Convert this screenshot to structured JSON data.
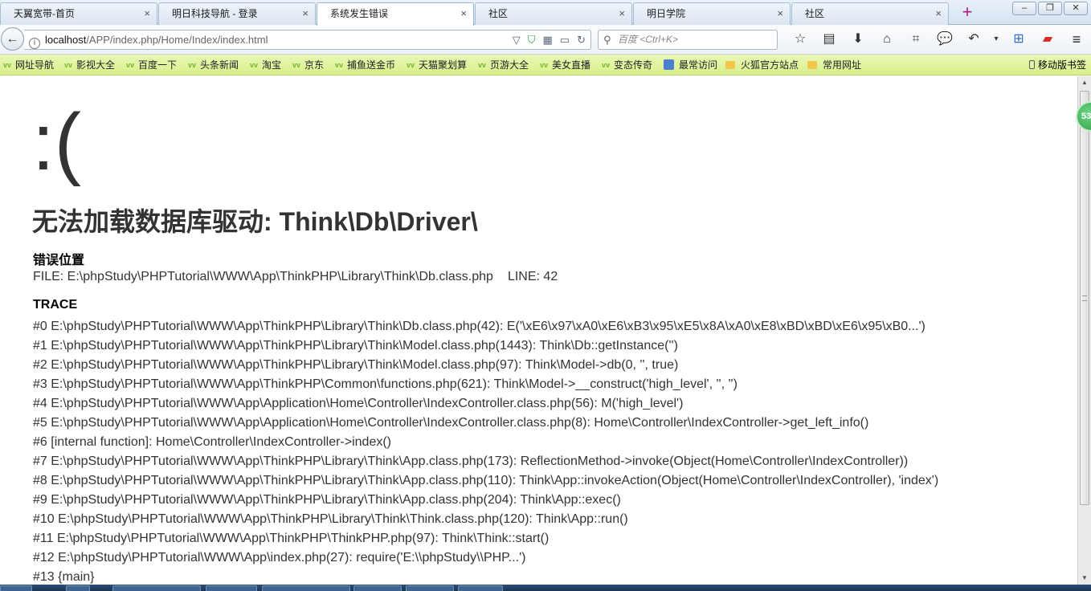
{
  "tabs": [
    {
      "title": "天翼宽带-首页",
      "active": false
    },
    {
      "title": "明日科技导航 - 登录",
      "active": false
    },
    {
      "title": "系统发生错误",
      "active": true
    },
    {
      "title": "社区",
      "active": false
    },
    {
      "title": "明日学院",
      "active": false
    },
    {
      "title": "社区",
      "active": false
    }
  ],
  "tab_close_glyph": "×",
  "new_tab_glyph": "+",
  "window_controls": {
    "minimize": "–",
    "restore": "❐",
    "close": "✕"
  },
  "nav": {
    "back_glyph": "←",
    "url_host": "localhost",
    "url_path": "/APP/index.php/Home/Index/index.html",
    "search_placeholder": "百度 <Ctrl+K>",
    "icons": [
      "bookmark-star-icon",
      "reading-list-icon",
      "download-icon",
      "home-icon",
      "screenshot-crop-icon",
      "chat-icon",
      "undo-icon",
      "dropdown-icon",
      "add-panel-icon",
      "extension-icon",
      "menu-icon"
    ]
  },
  "bookmarks": [
    {
      "label": "网址导航"
    },
    {
      "label": "影视大全"
    },
    {
      "label": "百度一下"
    },
    {
      "label": "头条新闻"
    },
    {
      "label": "淘宝"
    },
    {
      "label": "京东"
    },
    {
      "label": "捕鱼送金币"
    },
    {
      "label": "天猫聚划算"
    },
    {
      "label": "页游大全"
    },
    {
      "label": "美女直播"
    },
    {
      "label": "变态传奇"
    },
    {
      "label": "最常访问"
    },
    {
      "label": "火狐官方站点"
    },
    {
      "label": "常用网址"
    }
  ],
  "bookmark_mobile": "移动版书签",
  "error": {
    "face": ":(",
    "title": "无法加载数据库驱动: Think\\Db\\Driver\\",
    "location_heading": "错误位置",
    "file": "FILE: E:\\phpStudy\\PHPTutorial\\WWW\\App\\ThinkPHP\\Library\\Think\\Db.class.php",
    "line": "LINE: 42",
    "trace_heading": "TRACE",
    "trace": [
      "#0 E:\\phpStudy\\PHPTutorial\\WWW\\App\\ThinkPHP\\Library\\Think\\Db.class.php(42): E('\\xE6\\x97\\xA0\\xE6\\xB3\\x95\\xE5\\x8A\\xA0\\xE8\\xBD\\xBD\\xE6\\x95\\xB0...')",
      "#1 E:\\phpStudy\\PHPTutorial\\WWW\\App\\ThinkPHP\\Library\\Think\\Model.class.php(1443): Think\\Db::getInstance('')",
      "#2 E:\\phpStudy\\PHPTutorial\\WWW\\App\\ThinkPHP\\Library\\Think\\Model.class.php(97): Think\\Model->db(0, '', true)",
      "#3 E:\\phpStudy\\PHPTutorial\\WWW\\App\\ThinkPHP\\Common\\functions.php(621): Think\\Model->__construct('high_level', '', '')",
      "#4 E:\\phpStudy\\PHPTutorial\\WWW\\App\\Application\\Home\\Controller\\IndexController.class.php(56): M('high_level')",
      "#5 E:\\phpStudy\\PHPTutorial\\WWW\\App\\Application\\Home\\Controller\\IndexController.class.php(8): Home\\Controller\\IndexController->get_left_info()",
      "#6 [internal function]: Home\\Controller\\IndexController->index()",
      "#7 E:\\phpStudy\\PHPTutorial\\WWW\\App\\ThinkPHP\\Library\\Think\\App.class.php(173): ReflectionMethod->invoke(Object(Home\\Controller\\IndexController))",
      "#8 E:\\phpStudy\\PHPTutorial\\WWW\\App\\ThinkPHP\\Library\\Think\\App.class.php(110): Think\\App::invokeAction(Object(Home\\Controller\\IndexController), 'index')",
      "#9 E:\\phpStudy\\PHPTutorial\\WWW\\App\\ThinkPHP\\Library\\Think\\App.class.php(204): Think\\App::exec()",
      "#10 E:\\phpStudy\\PHPTutorial\\WWW\\App\\ThinkPHP\\Library\\Think\\Think.class.php(120): Think\\App::run()",
      "#11 E:\\phpStudy\\PHPTutorial\\WWW\\App\\ThinkPHP\\ThinkPHP.php(97): Think\\Think::start()",
      "#12 E:\\phpStudy\\PHPTutorial\\WWW\\App\\index.php(27): require('E:\\\\phpStudy\\\\PHP...')",
      "#13 {main}"
    ]
  },
  "floating_badge": "53"
}
